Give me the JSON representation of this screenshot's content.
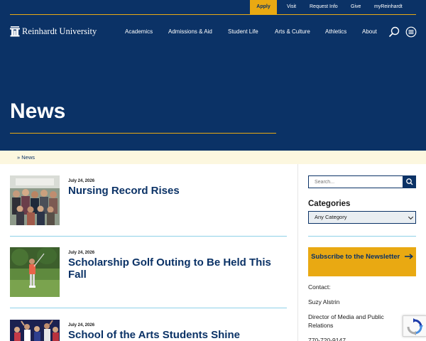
{
  "utility_nav": {
    "apply": "Apply",
    "visit": "Visit",
    "request_info": "Request Info",
    "give": "Give",
    "my_reinhardt": "myReinhardt"
  },
  "logo": {
    "text": "Reinhardt University"
  },
  "main_nav": {
    "academics": "Academics",
    "admissions": "Admissions & Aid",
    "student_life": "Student Life",
    "arts": "Arts & Culture",
    "athletics": "Athletics",
    "about": "About"
  },
  "page": {
    "title": "News"
  },
  "breadcrumb": {
    "separator": "»",
    "current": "News"
  },
  "articles": [
    {
      "date": "July 24, 2026",
      "title": "Nursing Record Rises"
    },
    {
      "date": "July 24, 2026",
      "title": "Scholarship Golf Outing to Be Held This Fall"
    },
    {
      "date": "July 24, 2026",
      "title": "School of the Arts Students Shine"
    }
  ],
  "sidebar": {
    "search_placeholder": "Search...",
    "categories_heading": "Categories",
    "category_selected": "Any Category",
    "subscribe_label": "Subscribe to the Newsletter",
    "contact_label": "Contact:",
    "contact_name": "Suzy Alstrin",
    "contact_role": "Director of Media and Public Relations",
    "contact_phone": "770-720-9147"
  },
  "colors": {
    "navy": "#0b3266",
    "gold": "#e9a912",
    "cream": "#fcf7df",
    "divider_blue": "#8fd1e8"
  },
  "icons": [
    "search-icon",
    "menu-icon",
    "arrow-right-icon",
    "recaptcha-icon"
  ]
}
